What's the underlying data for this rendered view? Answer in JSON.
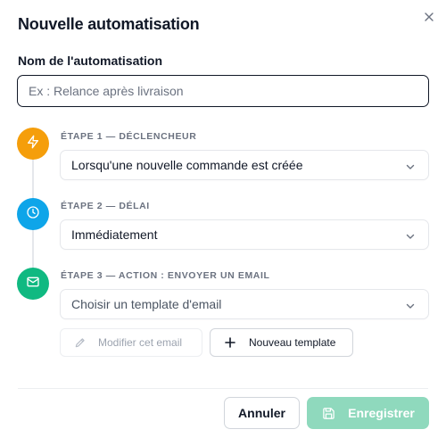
{
  "dialog": {
    "title": "Nouvelle automatisation",
    "close_icon": "close-icon"
  },
  "name_field": {
    "label": "Nom de l'automatisation",
    "value": "",
    "placeholder": "Ex : Relance après livraison"
  },
  "steps": [
    {
      "label": "ÉTAPE 1 — DÉCLENCHEUR",
      "icon": "lightning-icon",
      "color": "#f59e0b",
      "selected": "Lorsqu'une nouvelle commande est créée"
    },
    {
      "label": "ÉTAPE 2 — DÉLAI",
      "icon": "clock-icon",
      "color": "#0ea5e9",
      "selected": "Immédiatement"
    },
    {
      "label": "ÉTAPE 3 — ACTION : ENVOYER UN EMAIL",
      "icon": "mail-icon",
      "color": "#10b981",
      "selected": "Choisir un template d'email"
    }
  ],
  "actions": {
    "edit_email": "Modifier cet email",
    "new_template": "Nouveau template"
  },
  "footer": {
    "cancel": "Annuler",
    "save": "Enregistrer",
    "save_color": "#8fd9bd"
  }
}
